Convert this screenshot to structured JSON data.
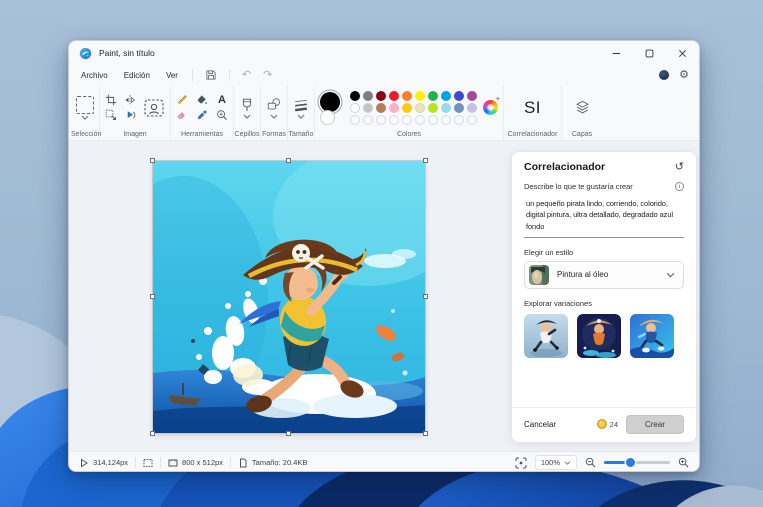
{
  "theme": {
    "accent": "#0067c0",
    "window_bg": "#f7f9fb",
    "workarea_bg": "#eef1f5",
    "panel_bg": "#ffffff",
    "slider_blue": "#2e7cd6",
    "create_button_bg": "#cfcfcf",
    "coin_gold": "#f0b92c"
  },
  "window": {
    "title": "Paint, sin título"
  },
  "menubar": {
    "items": [
      {
        "label": "Archivo"
      },
      {
        "label": "Edición"
      },
      {
        "label": "Ver"
      }
    ]
  },
  "icons": {
    "undo": "↶",
    "redo": "↷",
    "history": "↺",
    "gear": "⚙",
    "wheel_plus": "+",
    "info": "i"
  },
  "ribbon": {
    "groups": {
      "selection": "Selección",
      "image": "Imagen",
      "tools": "Herramientas",
      "brushes": "Cepillos",
      "shapes": "Formas",
      "size": "Tamaño",
      "colors": "Colores",
      "cocreator": "Correlacionador",
      "layers": "Capas"
    },
    "cocreator_button_text": "SI",
    "text_tool_glyph": "A",
    "palette": {
      "primary": "#000000",
      "secondary": "#ffffff",
      "row1": [
        "#000000",
        "#7f7f7f",
        "#880015",
        "#ed1c24",
        "#ff7f27",
        "#fff200",
        "#22b14c",
        "#00a2e8",
        "#3f48cc",
        "#a349a4"
      ],
      "row2": [
        "#ffffff",
        "#c3c3c3",
        "#b97a57",
        "#ffaec9",
        "#ffc90e",
        "#efe4b0",
        "#b5e61d",
        "#99d9ea",
        "#7092be",
        "#c8bfe7"
      ],
      "empty_count": 10
    }
  },
  "cocreator_panel": {
    "title": "Correlacionador",
    "prompt_label": "Describe lo que te gustaría crear",
    "prompt_text": "un pequeño pirata lindo, corriendo, colorido, digital pintura, ultra detallado, degradado azul fondo",
    "style_label": "Elegir un estilo",
    "style_value": "Pintura al óleo",
    "variations_label": "Explorar variaciones",
    "variations": [
      {
        "name": "pirate-kid-light-blue"
      },
      {
        "name": "pirate-kid-dark-navy"
      },
      {
        "name": "pirate-kid-bright-blue"
      }
    ],
    "footer": {
      "cancel_label": "Cancelar",
      "credits": "24",
      "create_label": "Crear"
    }
  },
  "statusbar": {
    "cursor_position": "314,124px",
    "canvas_size": "800 x 512px",
    "file_size": "Tamaño: 20.4KB",
    "zoom_level": "100%"
  }
}
